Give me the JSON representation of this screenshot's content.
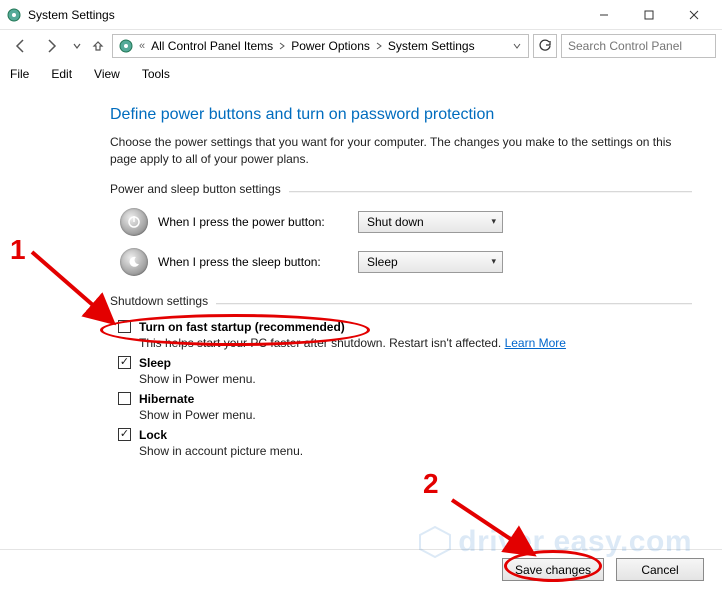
{
  "window": {
    "title": "System Settings",
    "min_icon": "minimize-icon",
    "max_icon": "maximize-icon",
    "close_icon": "close-icon"
  },
  "nav": {
    "breadcrumb_prep": "«",
    "crumbs": [
      {
        "label": "All Control Panel Items"
      },
      {
        "label": "Power Options"
      },
      {
        "label": "System Settings"
      }
    ],
    "search_placeholder": "Search Control Panel"
  },
  "menus": [
    "File",
    "Edit",
    "View",
    "Tools"
  ],
  "page": {
    "heading": "Define power buttons and turn on password protection",
    "desc": "Choose the power settings that you want for your computer. The changes you make to the settings on this page apply to all of your power plans.",
    "group_power": "Power and sleep button settings",
    "power_row": {
      "label": "When I press the power button:",
      "value": "Shut down"
    },
    "sleep_row": {
      "label": "When I press the sleep button:",
      "value": "Sleep"
    },
    "group_shutdown": "Shutdown settings",
    "items": [
      {
        "label": "Turn on fast startup (recommended)",
        "desc_pre": "This helps start your PC faster after shutdown. Restart isn't affected. ",
        "link": "Learn More",
        "checked": false
      },
      {
        "label": "Sleep",
        "desc_pre": "Show in Power menu.",
        "link": "",
        "checked": true
      },
      {
        "label": "Hibernate",
        "desc_pre": "Show in Power menu.",
        "link": "",
        "checked": false
      },
      {
        "label": "Lock",
        "desc_pre": "Show in account picture menu.",
        "link": "",
        "checked": true
      }
    ]
  },
  "buttons": {
    "save": "Save changes",
    "cancel": "Cancel"
  },
  "annotations": {
    "n1": "1",
    "n2": "2"
  },
  "watermark": "driver easy.com"
}
